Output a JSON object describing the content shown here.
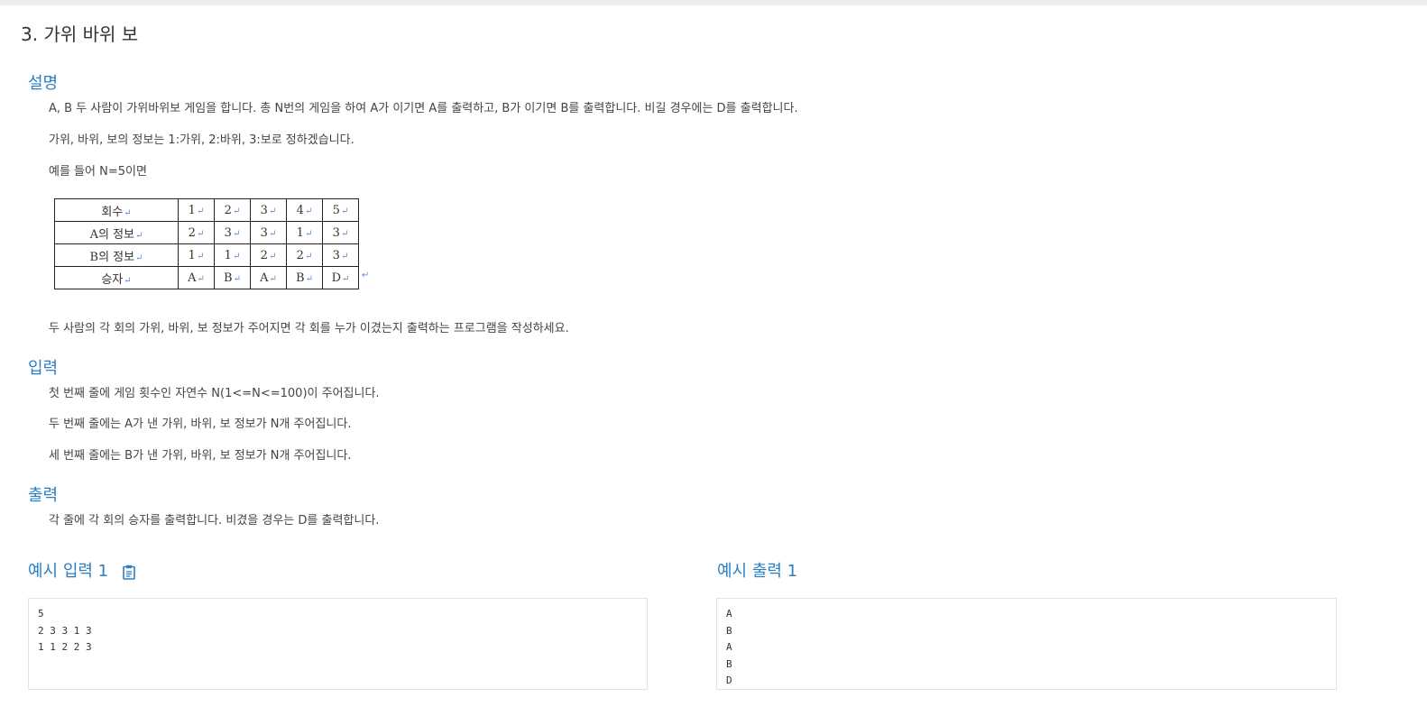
{
  "title": "3. 가위 바위 보",
  "description": {
    "heading": "설명",
    "paragraphs": [
      "A, B 두 사람이 가위바위보 게임을 합니다. 총 N번의 게임을 하여 A가 이기면 A를 출력하고, B가 이기면 B를 출력합니다. 비길 경우에는 D를 출력합니다.",
      "가위, 바위, 보의 정보는 1:가위, 2:바위, 3:보로 정하겠습니다.",
      "예를 들어 N=5이면"
    ],
    "table": {
      "return_mark": "↵",
      "rows": [
        {
          "label": "회수",
          "values": [
            "1",
            "2",
            "3",
            "4",
            "5"
          ]
        },
        {
          "label": "A의 정보",
          "values": [
            "2",
            "3",
            "3",
            "1",
            "3"
          ]
        },
        {
          "label": "B의 정보",
          "values": [
            "1",
            "1",
            "2",
            "2",
            "3"
          ]
        },
        {
          "label": "승자",
          "values": [
            "A",
            "B",
            "A",
            "B",
            "D"
          ]
        }
      ]
    },
    "after_table": "두 사람의 각 회의 가위, 바위, 보 정보가 주어지면 각 회를 누가 이겼는지 출력하는 프로그램을 작성하세요."
  },
  "input": {
    "heading": "입력",
    "paragraphs": [
      "첫 번째 줄에 게임 횟수인 자연수 N(1<=N<=100)이 주어집니다.",
      "두 번째 줄에는 A가 낸 가위, 바위, 보 정보가 N개 주어집니다.",
      "세 번째 줄에는 B가 낸 가위, 바위, 보 정보가 N개 주어집니다."
    ]
  },
  "output": {
    "heading": "출력",
    "paragraphs": [
      "각 줄에 각 회의 승자를 출력합니다. 비겼을 경우는 D를 출력합니다."
    ]
  },
  "examples": {
    "input_heading": "예시 입력 1",
    "output_heading": "예시 출력 1",
    "copy_icon": "clipboard-icon",
    "input_lines": [
      "5",
      "2 3 3 1 3",
      "1 1 2 2 3"
    ],
    "output_lines": [
      "A",
      "B",
      "A",
      "B",
      "D"
    ]
  },
  "colors": {
    "heading": "#2b7fc3",
    "return_mark": "#5b8fd6"
  }
}
